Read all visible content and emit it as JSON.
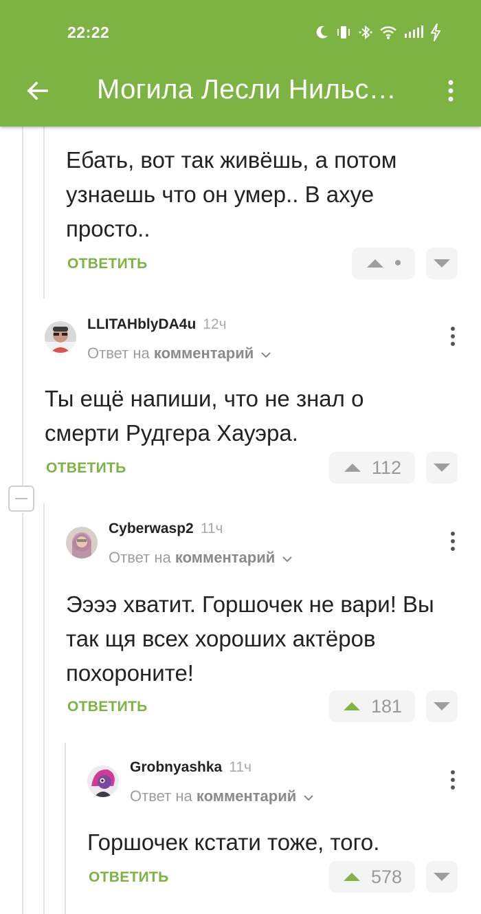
{
  "status_bar": {
    "time": "22:22",
    "icons": [
      "moon-icon",
      "vibrate-icon",
      "bluetooth-icon",
      "wifi-icon",
      "signal-icon",
      "charging-icon"
    ]
  },
  "app_bar": {
    "title": "Могила Лесли Нильсена",
    "back_icon": "arrow-left-icon",
    "menu_icon": "more-vert-icon"
  },
  "colors": {
    "accent": "#7cb342",
    "text": "#222222",
    "muted": "#9e9e9e"
  },
  "comments": [
    {
      "text": "Ебать, вот так живёшь, а потом узнаешь что он умер.. В ахуе просто..",
      "reply_label": "ОТВЕТИТЬ",
      "rating": "•"
    },
    {
      "author": "LLITAHblyDA4u",
      "time": "12ч",
      "reply_to_prefix": "Ответ на",
      "reply_to_target": "комментарий",
      "text": "Ты ещё напиши, что не знал о смерти Рудгера Хауэра.",
      "reply_label": "ОТВЕТИТЬ",
      "rating": "112"
    },
    {
      "author": "Cyberwasp2",
      "time": "11ч",
      "reply_to_prefix": "Ответ на",
      "reply_to_target": "комментарий",
      "text": "Ээээ хватит. Горшочек не вари! Вы так щя всех хороших актёров похороните!",
      "reply_label": "ОТВЕТИТЬ",
      "rating": "181"
    },
    {
      "author": "Grobnyashka",
      "time": "11ч",
      "reply_to_prefix": "Ответ на",
      "reply_to_target": "комментарий",
      "text": "Горшочек кстати тоже, того.",
      "reply_label": "ОТВЕТИТЬ",
      "rating": "578"
    }
  ]
}
